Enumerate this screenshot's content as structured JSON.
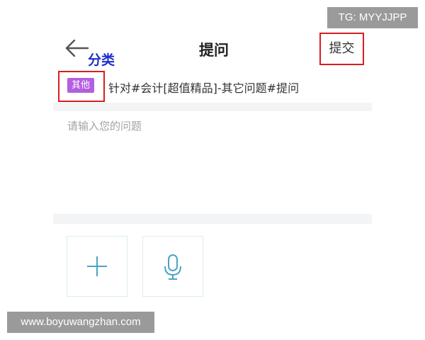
{
  "watermark_top": "TG: MYYJJPP",
  "header": {
    "back_icon": "arrow-left-icon",
    "title": "提问",
    "submit_label": "提交"
  },
  "annotation": {
    "category_note": "分类",
    "highlight_color": "#d61f1f",
    "note_color": "#1f2fc9"
  },
  "topic": {
    "tag": "其他",
    "tag_color": "#b45ee0",
    "text": "针对#会计[超值精品]-其它问题#提问"
  },
  "question": {
    "value": "",
    "placeholder": "请输入您的问题"
  },
  "attachments": [
    {
      "icon": "plus-icon",
      "accent": "#4aa3c4"
    },
    {
      "icon": "microphone-icon",
      "accent": "#4aa3c4"
    }
  ],
  "watermark_bottom": "www.boyuwangzhan.com"
}
